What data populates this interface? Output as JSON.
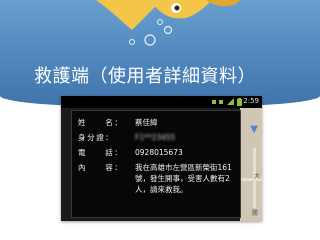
{
  "slide": {
    "title": "救護端（使用者詳細資料）"
  },
  "status_bar": {
    "time": "2:59"
  },
  "details": {
    "rows": [
      {
        "label": "姓　　名：",
        "value": "蔡佳緯"
      },
      {
        "label": "身分證：",
        "value": "F1**23455"
      },
      {
        "label": "電　　話：",
        "value": "0928015673"
      },
      {
        "label": "內　　容：",
        "value": "我在高雄市左營區新榮街161號，發生開事，受害人數有2人，請來救我。"
      }
    ]
  },
  "map": {
    "label_1": "大",
    "label_2": "勝"
  },
  "colors": {
    "banner_blue": "#4e86bd",
    "fish_yellow": "#f3c64a",
    "dialog_bg": "#070707"
  }
}
